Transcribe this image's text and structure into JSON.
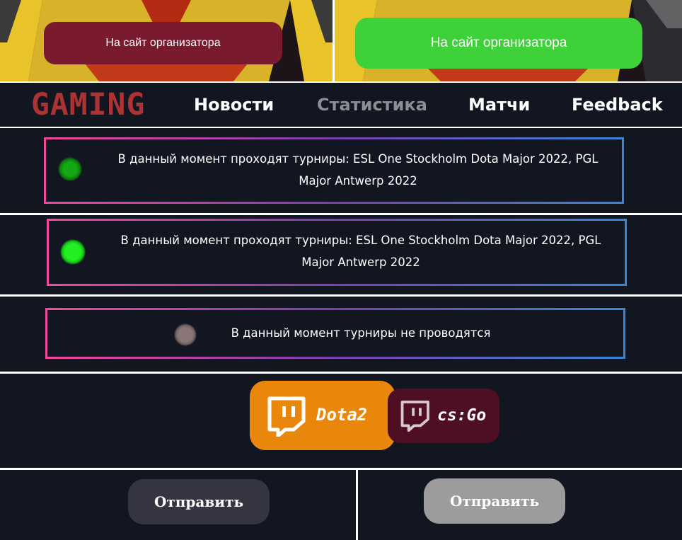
{
  "banner": {
    "left_button_label": "На сайт организатора",
    "right_button_label": "На сайт организатора",
    "left_button_color": "#7a1a2e",
    "right_button_color": "#3fd13a"
  },
  "navbar": {
    "logo": "GAMING",
    "items": [
      {
        "label": "Новости",
        "active": false
      },
      {
        "label": "Статистика",
        "active": true
      },
      {
        "label": "Матчи",
        "active": false
      },
      {
        "label": "Feedback",
        "active": false
      }
    ]
  },
  "statuses": [
    {
      "indicator": "dark-green",
      "text": "В данный момент проходят турниры: ESL One Stockholm Dota Major 2022, PGL Major Antwerp 2022"
    },
    {
      "indicator": "bright-green",
      "text": "В данный момент проходят турниры: ESL One Stockholm Dota Major 2022, PGL Major Antwerp 2022"
    },
    {
      "indicator": "grey",
      "text": "В данный момент турниры не проводятся"
    }
  ],
  "twitch": {
    "dota_label": "Dota2",
    "cs_label": "cs:Go",
    "dota_color": "#e8870b",
    "cs_color": "#4f0f23",
    "icon": "twitch-icon"
  },
  "submit": {
    "left_label": "Отправить",
    "right_label": "Отправить"
  }
}
